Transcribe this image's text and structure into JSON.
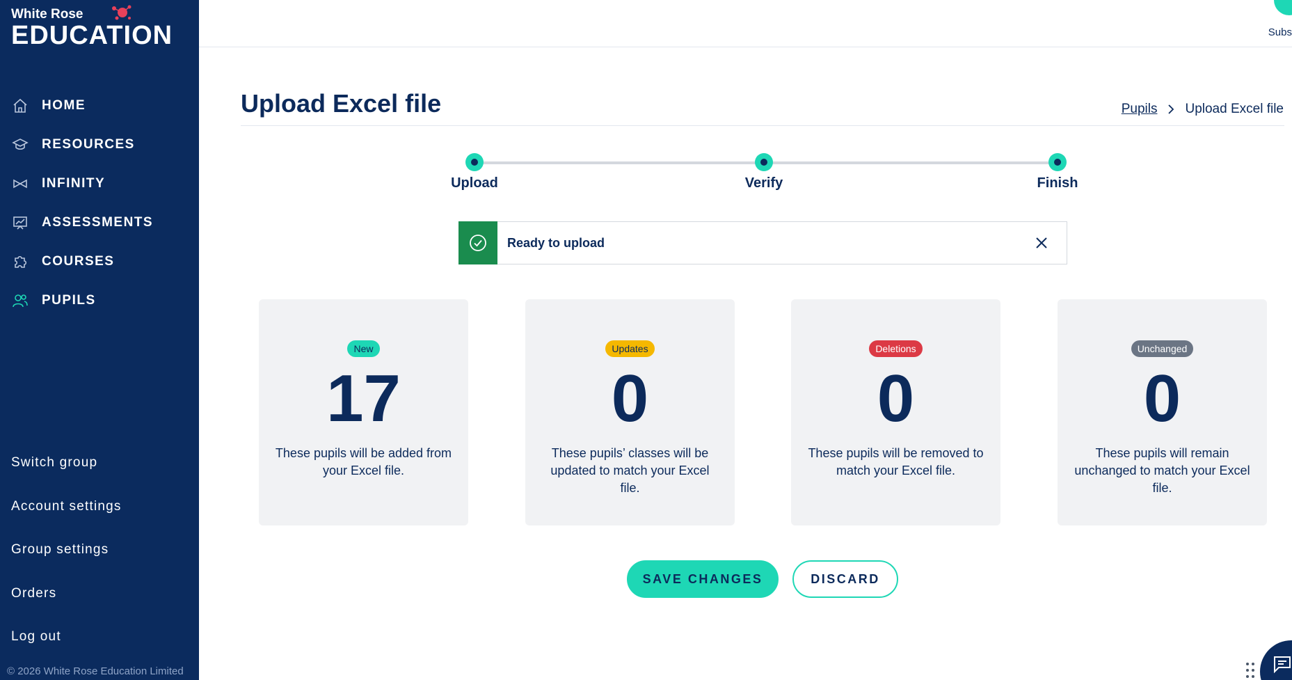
{
  "brand": {
    "line1": "White Rose",
    "line2": "EDUCATION"
  },
  "nav": {
    "items": [
      {
        "label": "HOME",
        "icon": "home-icon"
      },
      {
        "label": "RESOURCES",
        "icon": "graduation-cap-icon"
      },
      {
        "label": "INFINITY",
        "icon": "infinity-icon"
      },
      {
        "label": "ASSESSMENTS",
        "icon": "chart-board-icon"
      },
      {
        "label": "COURSES",
        "icon": "puzzle-icon"
      },
      {
        "label": "PUPILS",
        "icon": "users-icon"
      }
    ],
    "bottom": [
      "Switch group",
      "Account settings",
      "Group settings",
      "Orders",
      "Log out"
    ],
    "copyright": "© 2026 White Rose Education Limited"
  },
  "topbar": {
    "subscribe_label": "Subs"
  },
  "page": {
    "title": "Upload Excel file"
  },
  "breadcrumb": {
    "link": "Pupils",
    "current": "Upload Excel file"
  },
  "steps": [
    "Upload",
    "Verify",
    "Finish"
  ],
  "alert": {
    "text": "Ready to upload",
    "status_color": "#1a8c4e"
  },
  "cards": [
    {
      "badge": "New",
      "badge_color": "#1ed7b5",
      "badge_text_color": "#0c2a5b",
      "count": "17",
      "description": "These pupils will be added from your Excel file."
    },
    {
      "badge": "Updates",
      "badge_color": "#f5b800",
      "badge_text_color": "#0c2a5b",
      "count": "0",
      "description": "These pupils’ classes will be updated to match your Excel file."
    },
    {
      "badge": "Deletions",
      "badge_color": "#dc3a45",
      "badge_text_color": "#ffffff",
      "count": "0",
      "description": "These pupils will be removed to match your Excel file."
    },
    {
      "badge": "Unchanged",
      "badge_color": "#6b7584",
      "badge_text_color": "#ffffff",
      "count": "0",
      "description": "These pupils will remain unchanged to match your Excel file."
    }
  ],
  "actions": {
    "save": "SAVE CHANGES",
    "discard": "DISCARD"
  },
  "colors": {
    "sidebar": "#0b2b5e",
    "accent": "#1ed7b5",
    "text": "#0c2a5b"
  }
}
